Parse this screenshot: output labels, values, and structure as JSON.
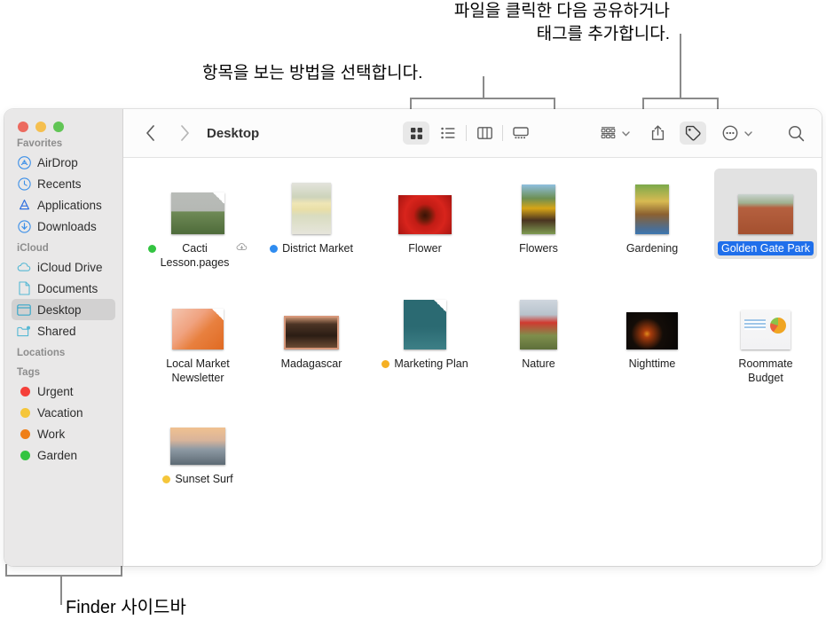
{
  "annotations": {
    "tag_callout": "파일을 클릭한 다음 공유하거나\n태그를 추가합니다.",
    "view_callout": "항목을 보는 방법을 선택합니다.",
    "sidebar_callout": "Finder 사이드바"
  },
  "window": {
    "title": "Desktop"
  },
  "toolbar": {
    "back_label": "‹",
    "forward_label": "›",
    "view_icon_label": "icon-view",
    "view_list_label": "list-view",
    "view_column_label": "column-view",
    "view_gallery_label": "gallery-view",
    "group_label": "group-by",
    "share_label": "share",
    "tag_label": "tags",
    "more_label": "more-actions",
    "search_label": "search"
  },
  "sidebar": {
    "sections": [
      {
        "header": "Favorites",
        "items": [
          {
            "label": "AirDrop",
            "icon": "airdrop-icon",
            "color": "#3b8fe8",
            "selected": false
          },
          {
            "label": "Recents",
            "icon": "clock-icon",
            "color": "#3b8fe8",
            "selected": false
          },
          {
            "label": "Applications",
            "icon": "appstore-icon",
            "color": "#2f6fe0",
            "selected": false
          },
          {
            "label": "Downloads",
            "icon": "download-icon",
            "color": "#3b8fe8",
            "selected": false
          }
        ]
      },
      {
        "header": "iCloud",
        "items": [
          {
            "label": "iCloud Drive",
            "icon": "cloud-icon",
            "color": "#56b8d4",
            "selected": false
          },
          {
            "label": "Documents",
            "icon": "document-icon",
            "color": "#56b8d4",
            "selected": false
          },
          {
            "label": "Desktop",
            "icon": "desktop-icon",
            "color": "#3aa7c9",
            "selected": true
          },
          {
            "label": "Shared",
            "icon": "shared-folder-icon",
            "color": "#56b8d4",
            "selected": false
          }
        ]
      },
      {
        "header": "Locations",
        "items": []
      },
      {
        "header": "Tags",
        "items": [
          {
            "label": "Urgent",
            "icon": "tag-dot",
            "color": "#f5403a",
            "selected": false
          },
          {
            "label": "Vacation",
            "icon": "tag-dot",
            "color": "#f5c63a",
            "selected": false
          },
          {
            "label": "Work",
            "icon": "tag-dot",
            "color": "#ef7f18",
            "selected": false
          },
          {
            "label": "Garden",
            "icon": "tag-dot",
            "color": "#33c441",
            "selected": false
          }
        ]
      }
    ]
  },
  "files": [
    {
      "name": "Cacti\nLesson.pages",
      "thumb": "t-cacti",
      "tag": "#33c441",
      "cloud": true,
      "selected": false
    },
    {
      "name": "District Market",
      "thumb": "t-district",
      "tag": "#2f8cf0",
      "cloud": false,
      "selected": false
    },
    {
      "name": "Flower",
      "thumb": "t-flower",
      "tag": null,
      "cloud": false,
      "selected": false
    },
    {
      "name": "Flowers",
      "thumb": "t-flowers",
      "tag": null,
      "cloud": false,
      "selected": false
    },
    {
      "name": "Gardening",
      "thumb": "t-gardening",
      "tag": null,
      "cloud": false,
      "selected": false
    },
    {
      "name": "Golden Gate Park",
      "thumb": "t-ggpark",
      "tag": null,
      "cloud": false,
      "selected": true
    },
    {
      "name": "Local Market\nNewsletter",
      "thumb": "t-newsletter",
      "tag": null,
      "cloud": false,
      "selected": false
    },
    {
      "name": "Madagascar",
      "thumb": "t-madagascar",
      "tag": null,
      "cloud": false,
      "selected": false
    },
    {
      "name": "Marketing Plan",
      "thumb": "t-marketing",
      "tag": "#f5b024",
      "cloud": false,
      "selected": false
    },
    {
      "name": "Nature",
      "thumb": "t-nature",
      "tag": null,
      "cloud": false,
      "selected": false
    },
    {
      "name": "Nighttime",
      "thumb": "t-nighttime",
      "tag": null,
      "cloud": false,
      "selected": false
    },
    {
      "name": "Roommate\nBudget",
      "thumb": "t-roommate",
      "tag": null,
      "cloud": false,
      "selected": false
    },
    {
      "name": "Sunset Surf",
      "thumb": "t-sunset",
      "tag": "#f5c63a",
      "cloud": false,
      "selected": false
    }
  ],
  "colors": {
    "selection_blue": "#1f6feb",
    "sidebar_bg": "#e9e8e8",
    "callout_line": "#8a8a8a"
  }
}
